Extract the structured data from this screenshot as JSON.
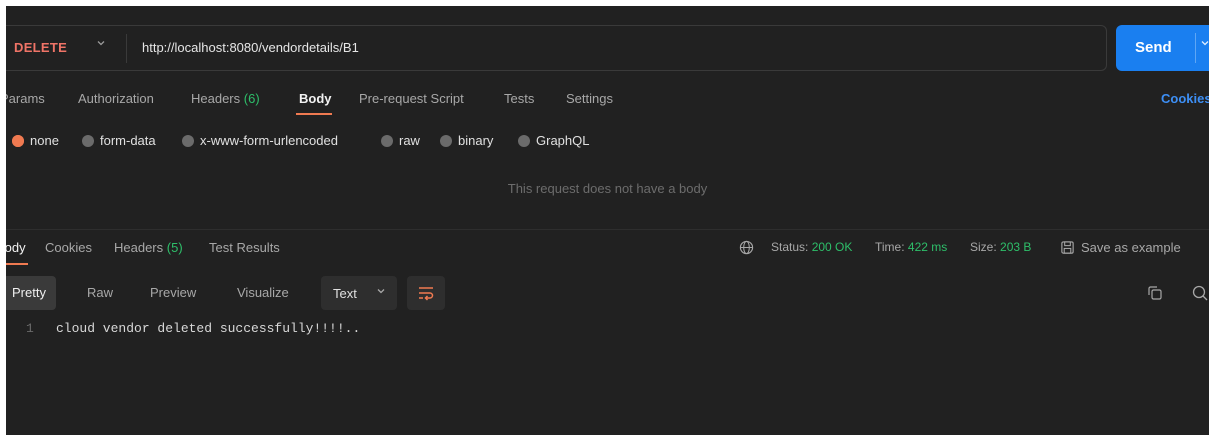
{
  "request": {
    "method": "DELETE",
    "url": "http://localhost:8080/vendordetails/B1",
    "send_label": "Send"
  },
  "request_tabs": {
    "params": "Params",
    "authorization": "Authorization",
    "headers": "Headers",
    "headers_count": "(6)",
    "body": "Body",
    "pre_request": "Pre-request Script",
    "tests": "Tests",
    "settings": "Settings",
    "cookies": "Cookies"
  },
  "body_types": {
    "selected": "none",
    "options": [
      "none",
      "form-data",
      "x-www-form-urlencoded",
      "raw",
      "binary",
      "GraphQL"
    ]
  },
  "empty_body_message": "This request does not have a body",
  "response_tabs": {
    "body": "Body",
    "cookies": "Cookies",
    "headers": "Headers",
    "headers_count": "(5)",
    "test_results": "Test Results"
  },
  "response_meta": {
    "status_label": "Status:",
    "status_value": "200 OK",
    "time_label": "Time:",
    "time_value": "422 ms",
    "size_label": "Size:",
    "size_value": "203 B",
    "save_example": "Save as example"
  },
  "view_modes": [
    "Pretty",
    "Raw",
    "Preview",
    "Visualize"
  ],
  "format": "Text",
  "response_body": [
    {
      "line": "1",
      "text": "cloud vendor deleted successfully!!!!.."
    }
  ],
  "colors": {
    "accent_orange": "#f07a51",
    "method_delete": "#f07467",
    "send_blue": "#1a7ff0",
    "status_green": "#2ebf6a",
    "link_blue": "#3d8ff5"
  }
}
